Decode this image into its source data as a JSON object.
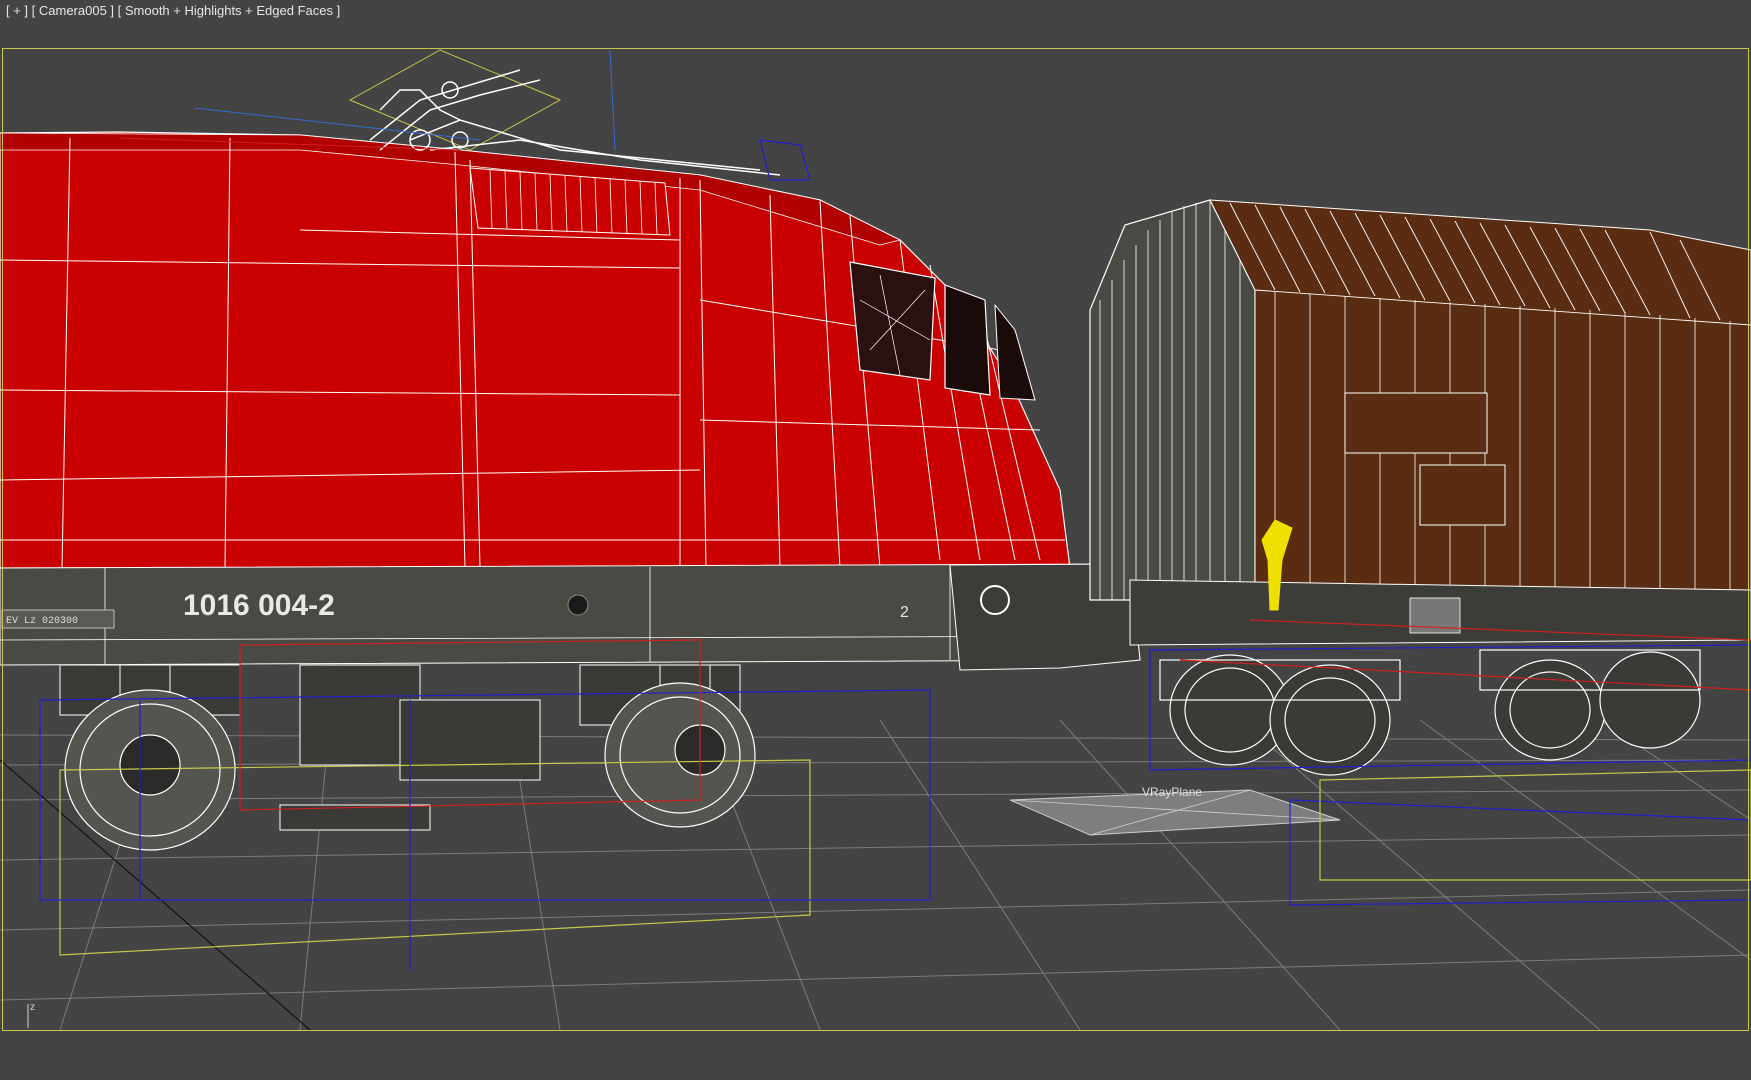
{
  "viewport": {
    "label": "[ + ] [ Camera005 ] [ Smooth + Highlights + Edged Faces ]",
    "frame_color": "#c8c84a",
    "background": "#444444"
  },
  "scene": {
    "locomotive": {
      "number": "1016 004-2",
      "body_color": "#c80000",
      "frame_color": "#4a4a44",
      "small_side_number": "2",
      "plate_text": "EV  Lz  020300"
    },
    "wagon": {
      "body_color": "#5a2c12"
    },
    "ground_plane": {
      "name": "VRayPlane"
    },
    "colors": {
      "wire_white": "#ffffff",
      "wire_blue": "#2020d0",
      "wire_yellow": "#c8c84a",
      "wire_red": "#d02020",
      "grid": "#7a7a7a",
      "selection": "#f0e000"
    }
  },
  "axis_tripod": {
    "label": "z"
  }
}
